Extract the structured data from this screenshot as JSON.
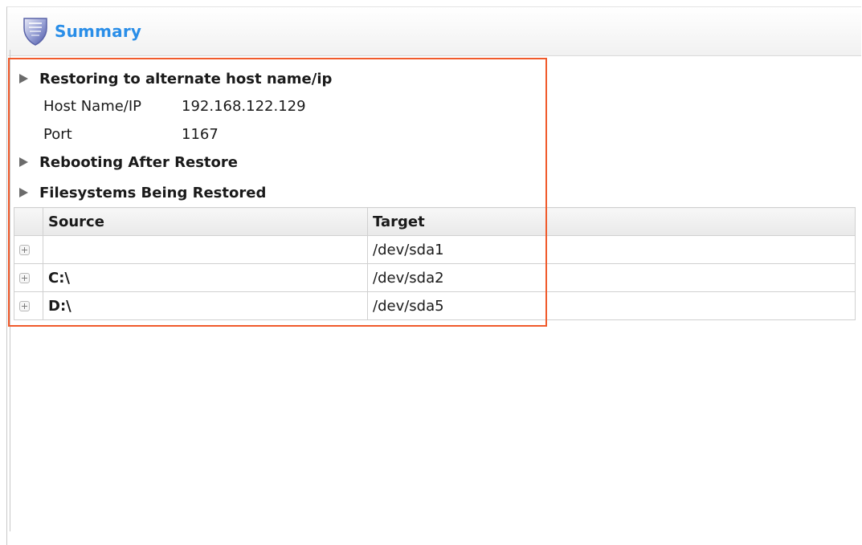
{
  "header": {
    "title": "Summary",
    "icon": "shield-icon"
  },
  "sections": {
    "alternate_host": {
      "title": "Restoring to alternate host name/ip",
      "fields": [
        {
          "label": "Host Name/IP",
          "value": "192.168.122.129"
        },
        {
          "label": "Port",
          "value": "1167"
        }
      ]
    },
    "rebooting": {
      "title": "Rebooting After Restore"
    },
    "filesystems": {
      "title": "Filesystems Being Restored"
    }
  },
  "table": {
    "columns": [
      "Source",
      "Target"
    ],
    "rows": [
      {
        "source": "",
        "target": "/dev/sda1"
      },
      {
        "source": "C:\\",
        "target": "/dev/sda2"
      },
      {
        "source": "D:\\",
        "target": "/dev/sda5"
      }
    ]
  },
  "colors": {
    "title": "#2a8ee8",
    "highlight": "#f05a2b"
  }
}
